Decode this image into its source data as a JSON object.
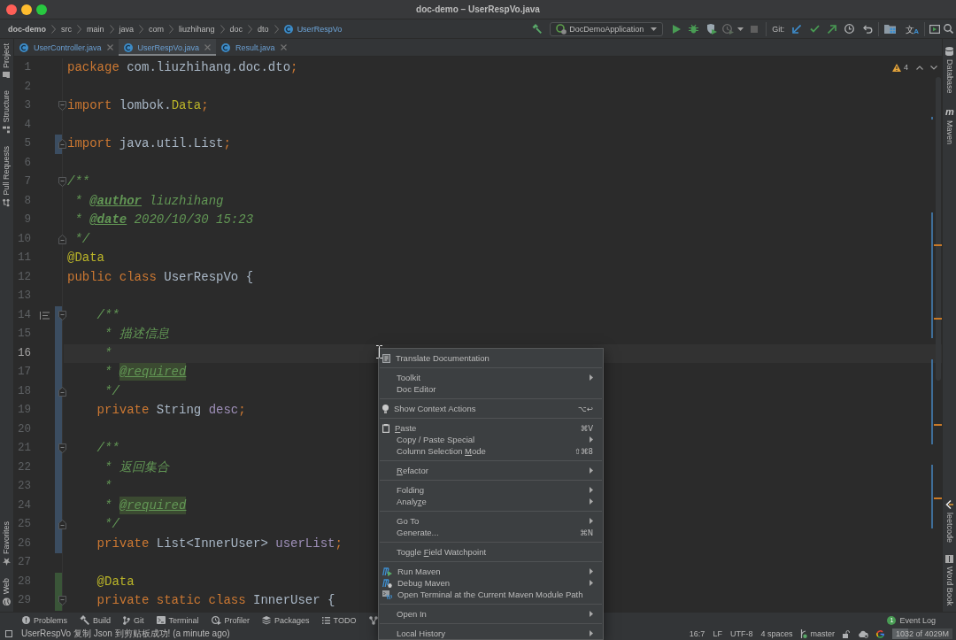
{
  "window": {
    "title": "doc-demo – UserRespVo.java"
  },
  "breadcrumbs": [
    {
      "label": "doc-demo",
      "kind": "project"
    },
    {
      "label": "src",
      "kind": "folder"
    },
    {
      "label": "main",
      "kind": "folder"
    },
    {
      "label": "java",
      "kind": "folder"
    },
    {
      "label": "com",
      "kind": "folder"
    },
    {
      "label": "liuzhihang",
      "kind": "folder"
    },
    {
      "label": "doc",
      "kind": "folder"
    },
    {
      "label": "dto",
      "kind": "folder"
    },
    {
      "label": "UserRespVo",
      "kind": "class"
    }
  ],
  "toolbar": {
    "run_config": "DocDemoApplication",
    "git_label": "Git:",
    "translate_glyphs": [
      "文",
      "A"
    ]
  },
  "left_tool_strip": {
    "top": [
      {
        "label": "Project"
      },
      {
        "label": "Structure"
      },
      {
        "label": "Pull Requests"
      }
    ],
    "bottom": [
      {
        "label": "Favorites"
      },
      {
        "label": "Web"
      }
    ]
  },
  "tabs": [
    {
      "label": "UserController.java",
      "selected": false
    },
    {
      "label": "UserRespVo.java",
      "selected": true
    },
    {
      "label": "Result.java",
      "selected": false
    }
  ],
  "editor": {
    "warnings": "4",
    "lines": [
      {
        "number": "1",
        "kind": "plain",
        "current": false,
        "tokens": [
          {
            "kind": "keyword",
            "text": "package"
          },
          {
            "kind": "plain",
            "text": " com.liuzhihang.doc.dto"
          },
          {
            "kind": "keyword",
            "text": ";"
          }
        ]
      },
      {
        "number": "2",
        "kind": "plain",
        "current": false
      },
      {
        "number": "3",
        "kind": "fold-start",
        "current": false,
        "tokens": [
          {
            "kind": "keyword",
            "text": "import"
          },
          {
            "kind": "plain",
            "text": " lombok."
          },
          {
            "kind": "annotation",
            "text": "Data"
          },
          {
            "kind": "keyword",
            "text": ";"
          }
        ]
      },
      {
        "number": "4",
        "kind": "plain",
        "current": false
      },
      {
        "number": "5",
        "kind": "fold-end",
        "current": false,
        "color": "#3b4d61",
        "tokens": [
          {
            "kind": "keyword",
            "text": "import"
          },
          {
            "kind": "plain",
            "text": " java.util.List"
          },
          {
            "kind": "keyword",
            "text": ";"
          }
        ]
      },
      {
        "number": "6",
        "kind": "plain",
        "current": false
      },
      {
        "number": "7",
        "kind": "fold-start",
        "current": false,
        "tokens": [
          {
            "kind": "comment",
            "text": "/**"
          }
        ]
      },
      {
        "number": "8",
        "kind": "plain",
        "current": false,
        "tokens": [
          {
            "kind": "comment",
            "text": " * "
          },
          {
            "kind": "doc-tag",
            "text": "@author"
          },
          {
            "kind": "comment",
            "text": " liuzhihang"
          }
        ]
      },
      {
        "number": "9",
        "kind": "plain",
        "current": false,
        "tokens": [
          {
            "kind": "comment",
            "text": " * "
          },
          {
            "kind": "doc-tag",
            "text": "@date"
          },
          {
            "kind": "comment",
            "text": " 2020/10/30 15:23"
          }
        ]
      },
      {
        "number": "10",
        "kind": "fold-end",
        "current": false,
        "tokens": [
          {
            "kind": "comment",
            "text": " */"
          }
        ]
      },
      {
        "number": "11",
        "kind": "plain",
        "current": false,
        "tokens": [
          {
            "kind": "annotation",
            "text": "@Data"
          }
        ]
      },
      {
        "number": "12",
        "kind": "plain",
        "current": false,
        "tokens": [
          {
            "kind": "keyword",
            "text": "public class"
          },
          {
            "kind": "plain",
            "text": " UserRespVo {"
          }
        ]
      },
      {
        "number": "13",
        "kind": "plain",
        "current": false
      },
      {
        "number": "14",
        "kind": "fold-start",
        "current": false,
        "color": "#3b4d61",
        "tokens": [
          {
            "kind": "comment",
            "text": "    /**"
          }
        ]
      },
      {
        "number": "15",
        "kind": "plain",
        "current": false,
        "color": "#3b4d61",
        "tokens": [
          {
            "kind": "comment",
            "text": "     * 描述信息"
          }
        ]
      },
      {
        "number": "16",
        "kind": "plain",
        "current": true,
        "color": "#3b4d61",
        "tokens": [
          {
            "kind": "comment",
            "text": "     *"
          }
        ]
      },
      {
        "number": "17",
        "kind": "plain",
        "current": false,
        "color": "#3b4d61",
        "tokens": [
          {
            "kind": "comment",
            "text": "     * "
          },
          {
            "kind": "unknown-tag",
            "text": "@required"
          }
        ]
      },
      {
        "number": "18",
        "kind": "fold-end",
        "current": false,
        "color": "#3b4d61",
        "tokens": [
          {
            "kind": "comment",
            "text": "     */"
          }
        ]
      },
      {
        "number": "19",
        "kind": "plain",
        "current": false,
        "color": "#3b4d61",
        "tokens": [
          {
            "kind": "keyword",
            "text": "    private"
          },
          {
            "kind": "plain",
            "text": " String "
          },
          {
            "kind": "field",
            "text": "desc"
          },
          {
            "kind": "keyword",
            "text": ";"
          }
        ]
      },
      {
        "number": "20",
        "kind": "plain",
        "current": false,
        "color": "#3b4d61"
      },
      {
        "number": "21",
        "kind": "fold-start",
        "current": false,
        "color": "#3b4d61",
        "tokens": [
          {
            "kind": "comment",
            "text": "    /**"
          }
        ]
      },
      {
        "number": "22",
        "kind": "plain",
        "current": false,
        "color": "#3b4d61",
        "tokens": [
          {
            "kind": "comment",
            "text": "     * 返回集合"
          }
        ]
      },
      {
        "number": "23",
        "kind": "plain",
        "current": false,
        "color": "#3b4d61",
        "tokens": [
          {
            "kind": "comment",
            "text": "     *"
          }
        ]
      },
      {
        "number": "24",
        "kind": "plain",
        "current": false,
        "color": "#3b4d61",
        "tokens": [
          {
            "kind": "comment",
            "text": "     * "
          },
          {
            "kind": "unknown-tag",
            "text": "@required"
          }
        ]
      },
      {
        "number": "25",
        "kind": "fold-end",
        "current": false,
        "color": "#3b4d61",
        "tokens": [
          {
            "kind": "comment",
            "text": "     */"
          }
        ]
      },
      {
        "number": "26",
        "kind": "plain",
        "current": false,
        "color": "#3b4d61",
        "tokens": [
          {
            "kind": "keyword",
            "text": "    private"
          },
          {
            "kind": "plain",
            "text": " List<InnerUser> "
          },
          {
            "kind": "field",
            "text": "userList"
          },
          {
            "kind": "keyword",
            "text": ";"
          }
        ]
      },
      {
        "number": "27",
        "kind": "plain",
        "current": false
      },
      {
        "number": "28",
        "kind": "plain",
        "current": false,
        "color": "#3a5538",
        "tokens": [
          {
            "kind": "annotation",
            "text": "    @Data"
          }
        ]
      },
      {
        "number": "29",
        "kind": "fold-start",
        "current": false,
        "color": "#3a5538",
        "tokens": [
          {
            "kind": "keyword",
            "text": "    private static class"
          },
          {
            "kind": "plain",
            "text": " InnerUser {"
          }
        ]
      }
    ]
  },
  "right_tool_strip": {
    "top": [
      {
        "label": "Database"
      },
      {
        "label": "Maven",
        "glyph": "m"
      }
    ],
    "bottom": [
      {
        "label": "leetcode"
      },
      {
        "label": "Word Book"
      }
    ]
  },
  "tool_window_bar": {
    "items": [
      {
        "label": "Problems"
      },
      {
        "label": "Build"
      },
      {
        "label": "Git"
      },
      {
        "label": "Terminal"
      },
      {
        "label": "Profiler"
      },
      {
        "label": "Packages"
      },
      {
        "label": "TODO"
      }
    ],
    "event_log": {
      "label": "Event Log",
      "count": "1"
    }
  },
  "status_bar": {
    "message": "UserRespVo 复制 Json 到剪贴板成功! (a minute ago)",
    "position": "16:7",
    "line_separator": "LF",
    "encoding": "UTF-8",
    "indent": "4 spaces",
    "branch": "master",
    "memory": {
      "text": "1032 of 4029M",
      "level": 0.26
    }
  },
  "context_menu": {
    "groups": [
      [
        {
          "label": "Translate Documentation",
          "submenu": false
        }
      ],
      [
        {
          "label": "Toolkit",
          "submenu": true
        },
        {
          "label": "Doc Editor",
          "submenu": false
        }
      ],
      [
        {
          "label": "Show Context Actions",
          "shortcut": "⌥↩",
          "submenu": false
        }
      ],
      [
        {
          "label_parts": [
            {
              "text": "P",
              "underlined": true
            },
            {
              "text": "aste",
              "underlined": false
            }
          ],
          "shortcut": "⌘V",
          "submenu": false
        },
        {
          "label": "Copy / Paste Special",
          "submenu": true
        },
        {
          "label_parts": [
            {
              "text": "Column Selection ",
              "underlined": false
            },
            {
              "text": "M",
              "underlined": true
            },
            {
              "text": "ode",
              "underlined": false
            }
          ],
          "shortcut": "⇧⌘8",
          "submenu": false
        }
      ],
      [
        {
          "label_parts": [
            {
              "text": "R",
              "underlined": true
            },
            {
              "text": "efactor",
              "underlined": false
            }
          ],
          "submenu": true
        }
      ],
      [
        {
          "label": "Folding",
          "submenu": true
        },
        {
          "label_parts": [
            {
              "text": "Analy",
              "underlined": false
            },
            {
              "text": "z",
              "underlined": true
            },
            {
              "text": "e",
              "underlined": false
            }
          ],
          "submenu": true
        }
      ],
      [
        {
          "label": "Go To",
          "submenu": true
        },
        {
          "label": "Generate...",
          "shortcut": "⌘N",
          "submenu": false
        }
      ],
      [
        {
          "label_parts": [
            {
              "text": "Toggle ",
              "underlined": false
            },
            {
              "text": "F",
              "underlined": true
            },
            {
              "text": "ield Watchpoint",
              "underlined": false
            }
          ],
          "submenu": false
        }
      ],
      [
        {
          "label": "Run Maven",
          "submenu": true
        },
        {
          "label": "Debug Maven",
          "submenu": true
        },
        {
          "label": "Open Terminal at the Current Maven Module Path",
          "submenu": false
        }
      ],
      [
        {
          "label": "Open In",
          "submenu": true
        }
      ],
      [
        {
          "label": "Local History",
          "submenu": true
        }
      ]
    ]
  }
}
